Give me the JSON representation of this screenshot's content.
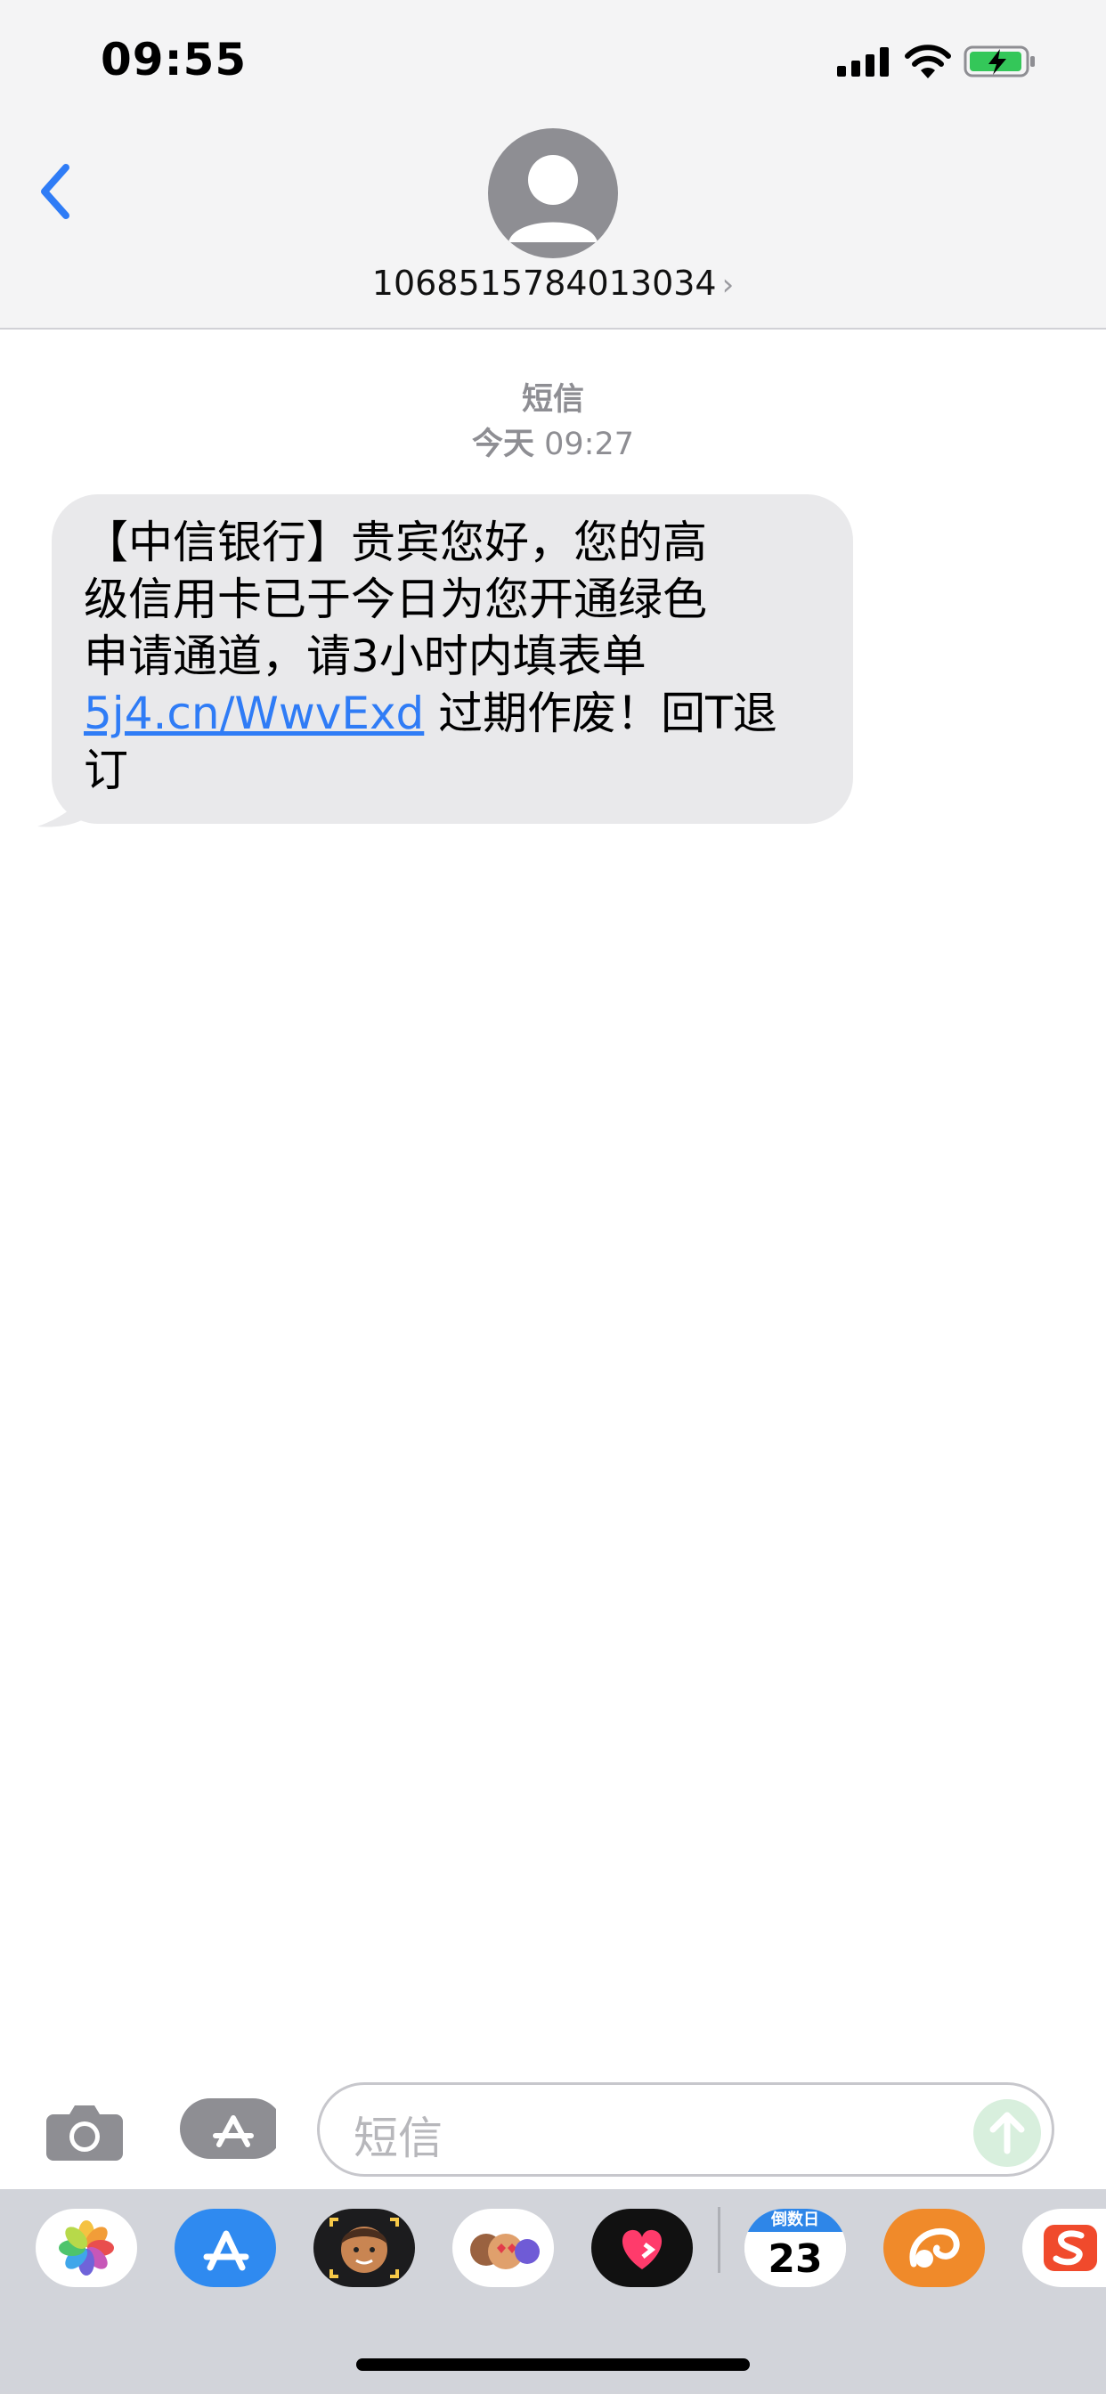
{
  "status_bar": {
    "time": "09:55"
  },
  "header": {
    "sender": "1068515784013034",
    "chevron": "›"
  },
  "conversation": {
    "kind": "短信",
    "day": "今天",
    "time": "09:27"
  },
  "message": {
    "lines": [
      "【中信银行】贵宾您好，您的高",
      "级信用卡已于今日为您开通绿色",
      "申请通道，请3小时内填表单"
    ],
    "link": "5j4.cn/WwvExd",
    "after_link": " 过期作废！回T退",
    "last_line": "订"
  },
  "composer": {
    "placeholder": "短信"
  },
  "tray": {
    "calendar_header": "倒数日",
    "calendar_number": "23"
  },
  "icons": {
    "back": "chevron-left-icon",
    "avatar": "person-icon",
    "camera": "camera-icon",
    "apps": "app-store-icon",
    "send": "arrow-up-icon"
  },
  "colors": {
    "link": "#2f7cf6",
    "bubble": "#e9e9eb",
    "send_disabled": "#d8efdd",
    "battery_charge": "#34c759"
  }
}
